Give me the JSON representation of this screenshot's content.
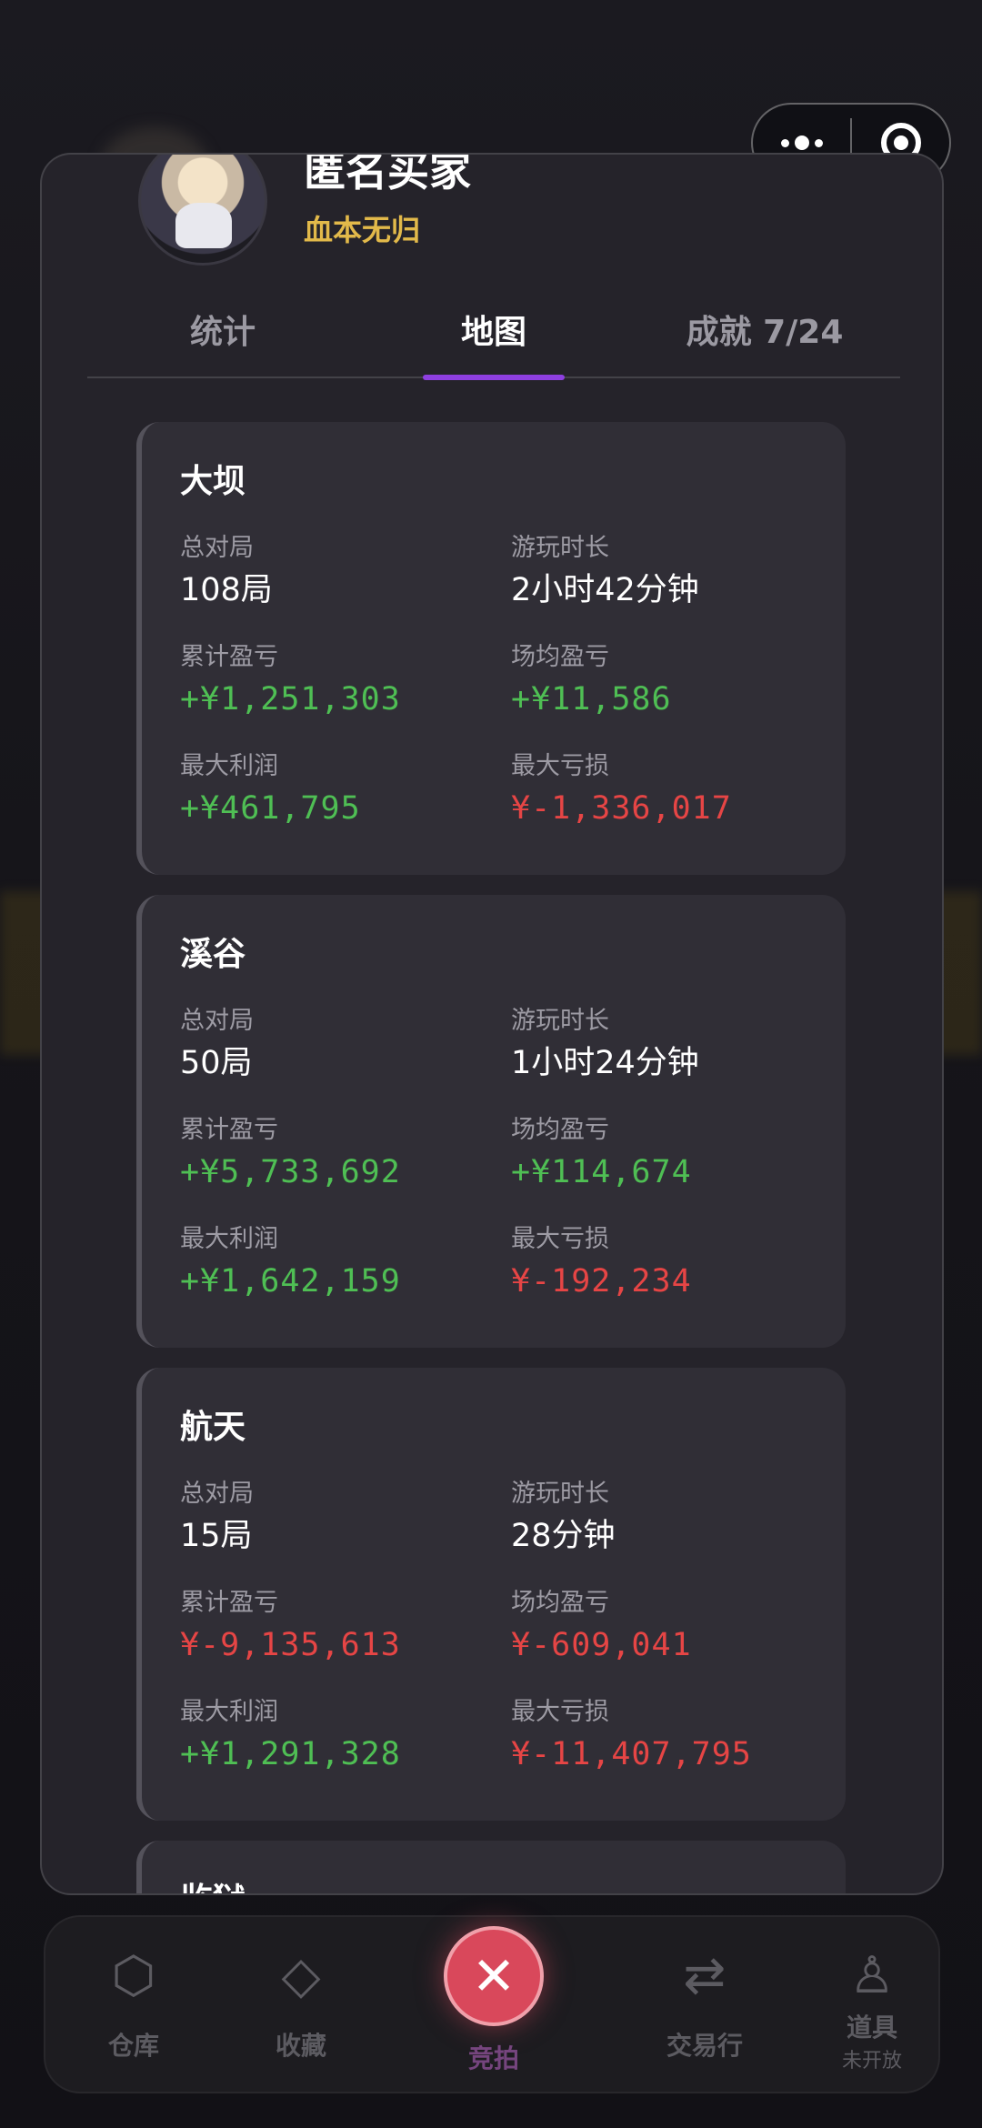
{
  "profile": {
    "name": "匿名买家",
    "title": "血本无归"
  },
  "tabs": [
    {
      "label": "统计"
    },
    {
      "label": "地图"
    },
    {
      "label": "成就 7/24"
    }
  ],
  "maps": [
    {
      "name": "大坝",
      "total_games_label": "总对局",
      "total_games": "108局",
      "play_time_label": "游玩时长",
      "play_time": "2小时42分钟",
      "total_pnl_label": "累计盈亏",
      "total_pnl": "+¥1,251,303",
      "avg_pnl_label": "场均盈亏",
      "avg_pnl": "+¥11,586",
      "max_profit_label": "最大利润",
      "max_profit": "+¥461,795",
      "max_loss_label": "最大亏损",
      "max_loss": "¥-1,336,017"
    },
    {
      "name": "溪谷",
      "total_games_label": "总对局",
      "total_games": "50局",
      "play_time_label": "游玩时长",
      "play_time": "1小时24分钟",
      "total_pnl_label": "累计盈亏",
      "total_pnl": "+¥5,733,692",
      "avg_pnl_label": "场均盈亏",
      "avg_pnl": "+¥114,674",
      "max_profit_label": "最大利润",
      "max_profit": "+¥1,642,159",
      "max_loss_label": "最大亏损",
      "max_loss": "¥-192,234"
    },
    {
      "name": "航天",
      "total_games_label": "总对局",
      "total_games": "15局",
      "play_time_label": "游玩时长",
      "play_time": "28分钟",
      "total_pnl_label": "累计盈亏",
      "total_pnl": "¥-9,135,613",
      "avg_pnl_label": "场均盈亏",
      "avg_pnl": "¥-609,041",
      "max_profit_label": "最大利润",
      "max_profit": "+¥1,291,328",
      "max_loss_label": "最大亏损",
      "max_loss": "¥-11,407,795"
    },
    {
      "name": "监狱"
    }
  ],
  "bottom_nav": {
    "warehouse": "仓库",
    "collection": "收藏",
    "auction": "竞拍",
    "exchange": "交易行",
    "items": "道具",
    "items_sub": "未开放"
  },
  "colors": {
    "profit": "#4fbf54",
    "loss": "#e64545",
    "accent": "#8e3fe0",
    "title_gold": "#e2b94a"
  }
}
